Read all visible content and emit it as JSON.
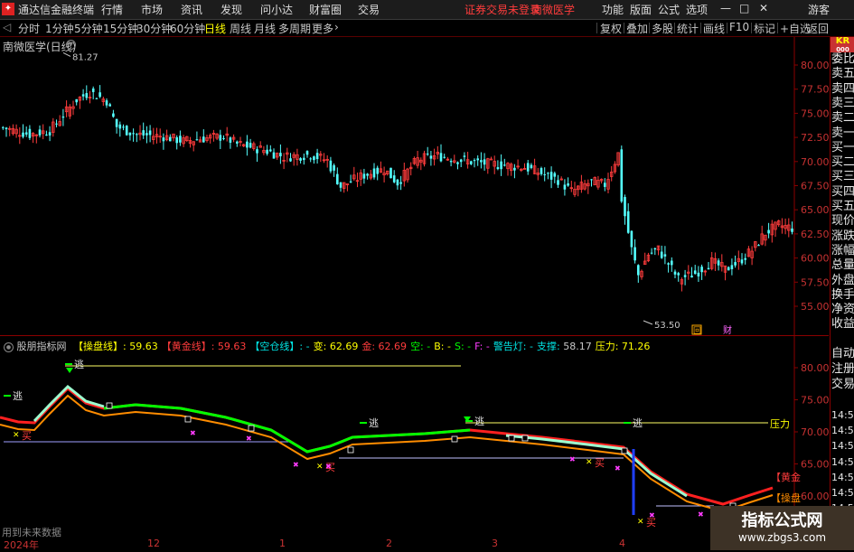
{
  "app": {
    "logo_char": "✦",
    "title": "通达信金融终端",
    "menus": [
      "行情",
      "市场",
      "资讯",
      "发现",
      "问小达",
      "财富圈",
      "交易"
    ],
    "notice": "证券交易未登录",
    "stock_name": "南微医学",
    "right_menus": [
      "功能",
      "版面",
      "公式",
      "选项"
    ],
    "window_controls": [
      "—",
      "□",
      "✕"
    ],
    "guest": "游客"
  },
  "periods": {
    "back_icon": "◁",
    "items": [
      "分时",
      "1分钟",
      "5分钟",
      "15分钟",
      "30分钟",
      "60分钟",
      "日线",
      "周线",
      "月线",
      "多周期",
      "更多"
    ],
    "active": "日线",
    "more_icon": "›"
  },
  "tools": [
    "复权",
    "叠加",
    "多股",
    "统计",
    "画线",
    "F10",
    "标记",
    "+自选",
    "返回"
  ],
  "main": {
    "title": "南微医学(日线)",
    "high_label": "81.27",
    "low_label": "53.50",
    "y_ticks": [
      "80.00",
      "77.50",
      "75.00",
      "72.50",
      "70.00",
      "67.50",
      "65.00",
      "62.50",
      "60.00",
      "57.50",
      "55.00"
    ],
    "markers": [
      "回",
      "财"
    ]
  },
  "indicator": {
    "name": "股朋指标网",
    "items": [
      {
        "label": "【操盘线】:",
        "value": "59.63",
        "label_color": "#ffff00",
        "value_color": "#ffff00"
      },
      {
        "label": "【黄金线】:",
        "value": "59.63",
        "label_color": "#ff3c3c",
        "value_color": "#ff3c3c"
      },
      {
        "label": "【空仓线】:",
        "value": "-",
        "label_color": "#00e5e5",
        "value_color": "#00e5e5"
      },
      {
        "label": "变:",
        "value": "62.69",
        "label_color": "#ffff00",
        "value_color": "#ffff00"
      },
      {
        "label": "金:",
        "value": "62.69",
        "label_color": "#ff3c3c",
        "value_color": "#ff3c3c"
      },
      {
        "label": "空:",
        "value": "-",
        "label_color": "#00ff00",
        "value_color": "#00ff00"
      },
      {
        "label": "B:",
        "value": "-",
        "label_color": "#ffff00",
        "value_color": "#ffff00"
      },
      {
        "label": "S:",
        "value": "-",
        "label_color": "#00ff00",
        "value_color": "#00ff00"
      },
      {
        "label": "F:",
        "value": "-",
        "label_color": "#ff3cff",
        "value_color": "#ff3cff"
      },
      {
        "label": "警告灯:",
        "value": "-",
        "label_color": "#00e5e5",
        "value_color": "#00e5e5"
      },
      {
        "label": "支撑:",
        "value": "58.17",
        "label_color": "#00e5e5",
        "value_color": "#c8c8c8"
      },
      {
        "label": "压力:",
        "value": "71.26",
        "label_color": "#ffff00",
        "value_color": "#ffff00"
      }
    ],
    "y_ticks": [
      "80.00",
      "75.00",
      "70.00",
      "65.00",
      "60.00"
    ],
    "signals": {
      "escape": "逃",
      "buy": "买",
      "pressure": "压力",
      "gold_label": "【黄金",
      "op_label": "【操盘",
      "future_note": "用到未来数据"
    }
  },
  "side": {
    "order_labels": [
      "委比",
      "卖五",
      "卖四",
      "卖三",
      "卖二",
      "卖一",
      "买一",
      "买二",
      "买三",
      "买四",
      "买五",
      "现价",
      "涨跌",
      "涨幅",
      "总量",
      "外盘",
      "换手",
      "净资",
      "收益"
    ],
    "badge": "KR",
    "badge_sub": "000",
    "lower_labels": [
      "自动",
      "注册",
      "交易"
    ],
    "times": [
      "14:5",
      "14:5",
      "14:5",
      "14:5",
      "14:5",
      "14:5",
      "14:5",
      "14:5"
    ]
  },
  "xaxis": [
    "2024年",
    "12",
    "1",
    "2",
    "3",
    "4"
  ],
  "watermark": {
    "title": "指标公式网",
    "url": "www.zbgs3.com"
  },
  "colors": {
    "up": "#ff3c3c",
    "down": "#54ffff",
    "gold": "#ff2020",
    "op": "#ff8c00",
    "empty": "#00ff00",
    "empty_light": "#a0ffd0"
  }
}
